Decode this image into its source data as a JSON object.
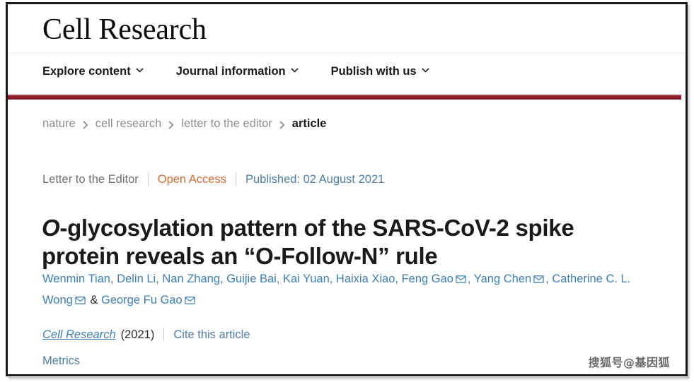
{
  "window": {
    "frame_color": "#1b1b1b",
    "page_background": "#ffffff"
  },
  "masthead": {
    "journal_title": "Cell Research",
    "brand_rule_color": "#8b1a2b"
  },
  "nav": {
    "items": [
      {
        "label": "Explore content",
        "icon": "chevron-down-icon"
      },
      {
        "label": "Journal information",
        "icon": "chevron-down-icon"
      },
      {
        "label": "Publish with us",
        "icon": "chevron-down-icon"
      }
    ]
  },
  "breadcrumb": {
    "separator_icon": "chevron-right-icon",
    "items": [
      {
        "label": "nature",
        "current": false
      },
      {
        "label": "cell research",
        "current": false
      },
      {
        "label": "letter to the editor",
        "current": false
      },
      {
        "label": "article",
        "current": true
      }
    ]
  },
  "article": {
    "meta": {
      "type": "Letter to the Editor",
      "access": "Open Access",
      "access_color": "#d96a32",
      "published": "Published: 02 August 2021",
      "published_color": "#4f7ea8"
    },
    "title_parts": [
      {
        "text": "O",
        "italic": true
      },
      {
        "text": "-glycosylation pattern of the SARS-CoV-2 spike protein reveals an “O-Follow-N” rule",
        "italic": false
      }
    ],
    "title_plain": "O-glycosylation pattern of the SARS-CoV-2 spike protein reveals an “O-Follow-N” rule",
    "authors": [
      {
        "name": "Wenmin Tian",
        "corresponding": false
      },
      {
        "name": "Delin Li",
        "corresponding": false
      },
      {
        "name": "Nan Zhang",
        "corresponding": false
      },
      {
        "name": "Guijie Bai",
        "corresponding": false
      },
      {
        "name": "Kai Yuan",
        "corresponding": false
      },
      {
        "name": "Haixia Xiao",
        "corresponding": false
      },
      {
        "name": "Feng Gao",
        "corresponding": true
      },
      {
        "name": "Yang Chen",
        "corresponding": true
      },
      {
        "name": "Catherine C. L. Wong",
        "corresponding": true
      },
      {
        "name": "George Fu Gao",
        "corresponding": true
      }
    ],
    "author_separator": ", ",
    "author_last_separator": " & ",
    "corresponding_icon": "envelope-icon",
    "citation": {
      "journal": "Cell Research",
      "year": "(2021)",
      "cite_label": "Cite this article"
    },
    "metrics_label": "Metrics"
  },
  "watermark": {
    "text": "搜狐号@基因狐"
  }
}
